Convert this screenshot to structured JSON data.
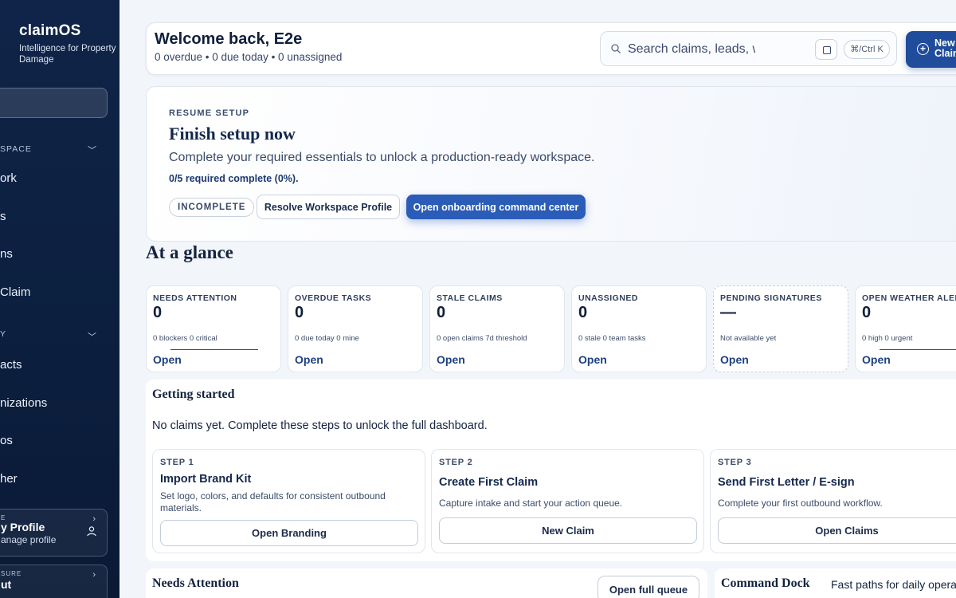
{
  "sidebar": {
    "brand_name": "claimOS",
    "brand_tagline": "Intelligence for Property Damage",
    "section_workspace": "SPACE",
    "items": [
      {
        "label": "ork"
      },
      {
        "label": "s"
      },
      {
        "label": "ns"
      },
      {
        "label": "Claim"
      }
    ],
    "section_second": "Y",
    "items2": [
      {
        "label": "acts"
      },
      {
        "label": "nizations"
      },
      {
        "label": "os"
      },
      {
        "label": "her"
      }
    ],
    "profile_card": {
      "eyebrow": "E",
      "title": "y Profile",
      "subtitle": "anage profile"
    },
    "bottom_card": {
      "eyebrow": "SURE",
      "title": "ut"
    }
  },
  "header": {
    "welcome": "Welcome back, E2e",
    "summary": "0 overdue • 0 due today • 0 unassigned",
    "search_placeholder": "Search claims, leads, work",
    "shortcut": "⌘/Ctrl K",
    "new_claim_label": "New Claim"
  },
  "setup": {
    "eyebrow": "RESUME SETUP",
    "title": "Finish setup now",
    "description": "Complete your required essentials to unlock a production-ready workspace.",
    "progress": "0/5 required complete (0%).",
    "status_pill": "INCOMPLETE",
    "resolve_button": "Resolve Workspace Profile",
    "open_button": "Open onboarding command center"
  },
  "glance": {
    "title": "At a glance",
    "cards": [
      {
        "label": "NEEDS ATTENTION",
        "value": "0",
        "sub": "0 blockers   0 critical",
        "link": "Open"
      },
      {
        "label": "OVERDUE TASKS",
        "value": "0",
        "sub": "0 due today   0 mine",
        "link": "Open"
      },
      {
        "label": "STALE CLAIMS",
        "value": "0",
        "sub": "0 open claims   7d threshold",
        "link": "Open"
      },
      {
        "label": "UNASSIGNED",
        "value": "0",
        "sub": "0 stale   0 team tasks",
        "link": "Open"
      },
      {
        "label": "PENDING SIGNATURES",
        "value": "—",
        "sub": "Not available yet",
        "link": "Open"
      },
      {
        "label": "OPEN WEATHER ALERTS",
        "value": "0",
        "sub": "0 high   0 urgent",
        "link": "Open"
      }
    ]
  },
  "getting_started": {
    "title": "Getting started",
    "description": "No claims yet. Complete these steps to unlock the full dashboard.",
    "steps": [
      {
        "step": "STEP 1",
        "title": "Import Brand Kit",
        "desc": "Set logo, colors, and defaults for consistent outbound materials.",
        "button": "Open Branding"
      },
      {
        "step": "STEP 2",
        "title": "Create First Claim",
        "desc": "Capture intake and start your action queue.",
        "button": "New Claim"
      },
      {
        "step": "STEP 3",
        "title": "Send First Letter / E-sign",
        "desc": "Complete your first outbound workflow.",
        "button": "Open Claims"
      }
    ]
  },
  "needs_attention": {
    "title": "Needs Attention",
    "button": "Open full queue"
  },
  "command_dock": {
    "title": "Command Dock",
    "subtitle": "Fast paths for daily operations"
  },
  "colors": {
    "sidebar_bg": "#0f2448",
    "primary": "#2a5cb8",
    "accent_dark": "#1f4d9b"
  }
}
